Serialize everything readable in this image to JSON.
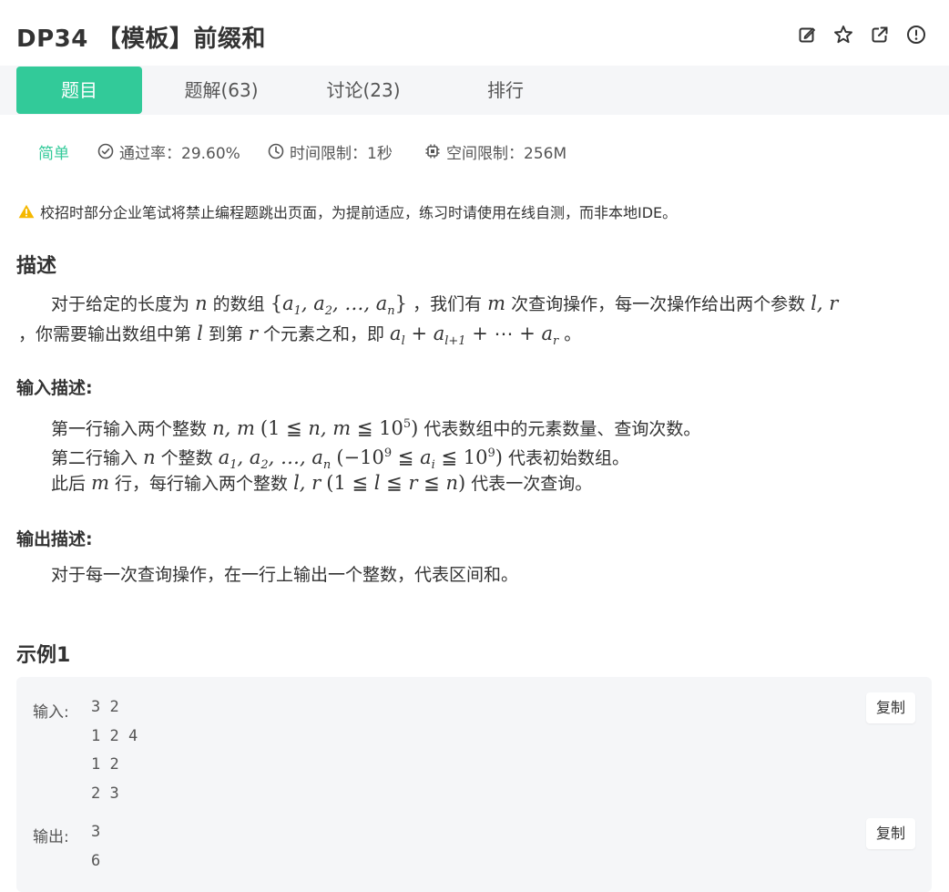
{
  "problem": {
    "title": "DP34 【模板】前缀和"
  },
  "header_icons": [
    "edit-icon",
    "star-icon",
    "external-link-icon",
    "report-icon"
  ],
  "tabs": [
    {
      "label": "题目",
      "active": true
    },
    {
      "label": "题解(63)",
      "active": false
    },
    {
      "label": "讨论(23)",
      "active": false
    },
    {
      "label": "排行",
      "active": false
    }
  ],
  "meta": {
    "difficulty": "简单",
    "pass_rate": "通过率：29.60%",
    "time_limit": "时间限制：1秒",
    "space_limit": "空间限制：256M"
  },
  "warning": "校招时部分企业笔试将禁止编程题跳出页面，为提前适应，练习时请使用在线自测，而非本地IDE。",
  "description": {
    "heading": "描述",
    "line1_a": "对于给定的长度为",
    "line1_b": "的数组",
    "line1_c": "，我们有",
    "line1_d": "次查询操作，每一次操作给出两个参数",
    "line2_a": "，你需要输出数组中第",
    "line2_b": "到第",
    "line2_c": "个元素之和，即",
    "line2_d": "。"
  },
  "input_desc": {
    "heading": "输入描述:",
    "l1_a": "第一行输入两个整数",
    "l1_b": "代表数组中的元素数量、查询次数。",
    "l2_a": "第二行输入",
    "l2_b": "个整数",
    "l2_c": "代表初始数组。",
    "l3_a": "此后",
    "l3_b": "行，每行输入两个整数",
    "l3_c": "代表一次查询。"
  },
  "output_desc": {
    "heading": "输出描述:",
    "text": "对于每一次查询操作，在一行上输出一个整数，代表区间和。"
  },
  "example": {
    "heading": "示例1",
    "input_label": "输入:",
    "input_lines": "3 2\n1 2 4\n1 2\n2 3",
    "output_label": "输出:",
    "output_lines": "3\n6",
    "copy_label": "复制"
  },
  "colors": {
    "accent": "#32ca99",
    "warning": "#f5b800",
    "tab_bar_bg": "#f5f6f8"
  }
}
